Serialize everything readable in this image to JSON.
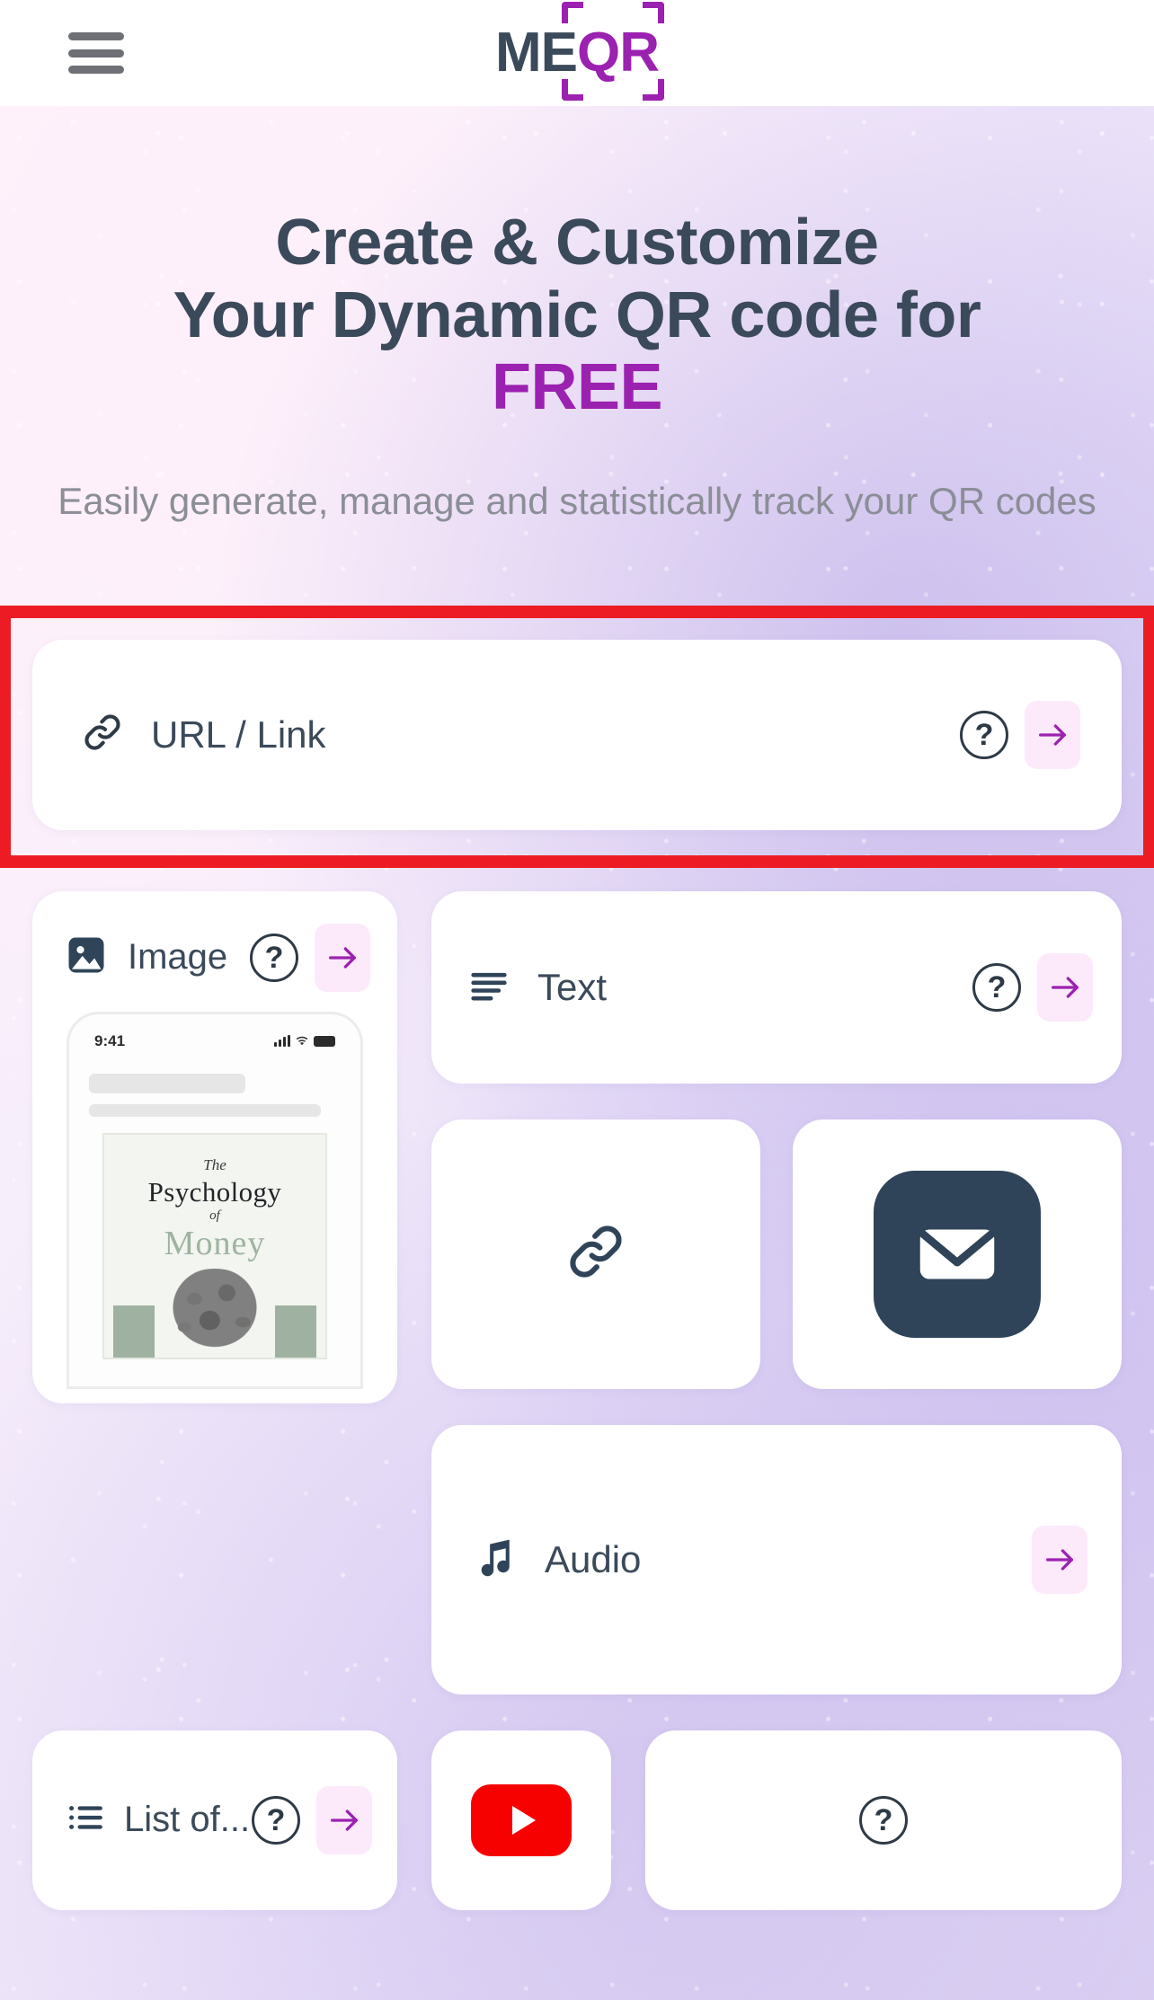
{
  "brand": {
    "logo_me": "ME",
    "logo_qr": "QR"
  },
  "header": {
    "menu_icon": "hamburger-menu-icon"
  },
  "hero": {
    "headline_line1": "Create & Customize",
    "headline_line2": "Your Dynamic QR code for",
    "headline_free": "FREE",
    "subheadline": "Easily generate, manage and statistically track your QR codes"
  },
  "colors": {
    "brand_purple": "#9b21b0",
    "dark_navy": "#3b4a5a",
    "highlight_red": "#ed1c24",
    "arrow_btn_bg": "#fceafb",
    "email_badge": "#2f4458",
    "youtube_red": "#f60000"
  },
  "cards": {
    "url": {
      "label": "URL / Link",
      "icon": "link-chain-icon",
      "help": "?",
      "arrow": "arrow-right-icon",
      "highlighted": true
    },
    "image": {
      "label": "Image",
      "icon": "image-picture-icon",
      "help": "?",
      "arrow": "arrow-right-icon",
      "preview": {
        "status_time": "9:41",
        "book_the": "The",
        "book_title": "Psychology",
        "book_of": "of",
        "book_subject": "Money"
      }
    },
    "text": {
      "label": "Text",
      "icon": "text-lines-icon",
      "help": "?",
      "arrow": "arrow-right-icon"
    },
    "link_tile": {
      "label": "",
      "icon": "link-chain-icon"
    },
    "email_tile": {
      "label": "",
      "icon": "envelope-mail-icon"
    },
    "audio": {
      "label": "Audio",
      "icon": "music-note-icon",
      "arrow": "arrow-right-icon"
    },
    "bottom": {
      "list_label": "List of...",
      "list_icon": "list-icon",
      "list_help": "?",
      "list_arrow": "arrow-right-icon",
      "youtube_icon": "youtube-play-icon",
      "misc_help": "?"
    }
  }
}
